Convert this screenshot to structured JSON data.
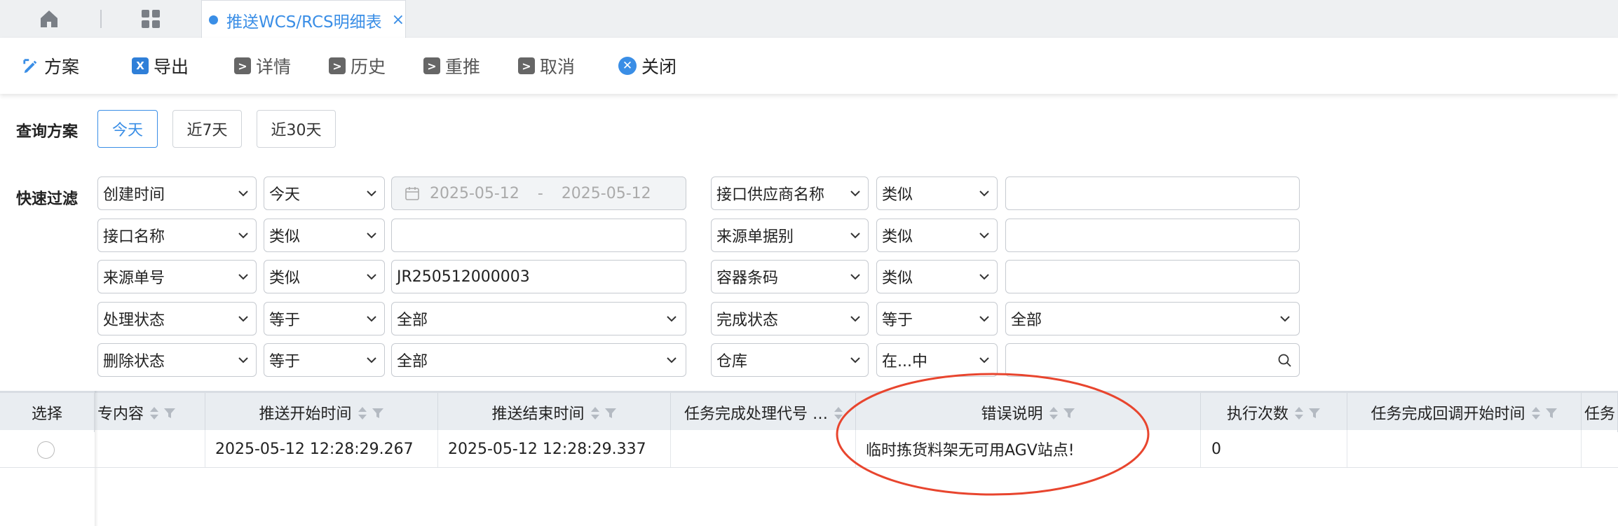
{
  "tabs": {
    "active_title": "推送WCS/RCS明细表",
    "close_symbol": "×"
  },
  "toolbar": {
    "plan": "方案",
    "export": "导出",
    "detail": "详情",
    "history": "历史",
    "repush": "重推",
    "cancel": "取消",
    "close": "关闭",
    "gray_icon_glyph": ">"
  },
  "query": {
    "label": "查询方案",
    "chips": [
      "今天",
      "近7天",
      "近30天"
    ],
    "active_chip": "今天"
  },
  "quick_filter": {
    "label": "快速过滤",
    "rows_left": [
      {
        "field": "创建时间",
        "op": "今天",
        "date_from": "2025-05-12",
        "date_sep": "-",
        "date_to": "2025-05-12"
      },
      {
        "field": "接口名称",
        "op": "类似",
        "value": ""
      },
      {
        "field": "来源单号",
        "op": "类似",
        "value": "JR250512000003"
      },
      {
        "field": "处理状态",
        "op": "等于",
        "value": "全部"
      },
      {
        "field": "删除状态",
        "op": "等于",
        "value": "全部"
      }
    ],
    "rows_right": [
      {
        "field": "接口供应商名称",
        "op": "类似",
        "value": ""
      },
      {
        "field": "来源单据别",
        "op": "类似",
        "value": ""
      },
      {
        "field": "容器条码",
        "op": "类似",
        "value": ""
      },
      {
        "field": "完成状态",
        "op": "等于",
        "value": "全部"
      },
      {
        "field": "仓库",
        "op": "在...中",
        "value": ""
      }
    ]
  },
  "table": {
    "columns": [
      "选择",
      "专内容",
      "推送开始时间",
      "推送结束时间",
      "任务完成处理代号 …",
      "错误说明",
      "执行次数",
      "任务完成回调开始时间",
      "任务"
    ],
    "rows": [
      {
        "content": "",
        "push_start": "2025-05-12 12:28:29.267",
        "push_end": "2025-05-12 12:28:29.337",
        "task_code": "",
        "error": "临时拣货料架无可用AGV站点!",
        "exec_count": "0",
        "callback_start": "",
        "task": ""
      }
    ]
  },
  "colors": {
    "accent": "#3a8ee6",
    "annotation": "#e8452e",
    "header_bg": "#e9edf1"
  }
}
